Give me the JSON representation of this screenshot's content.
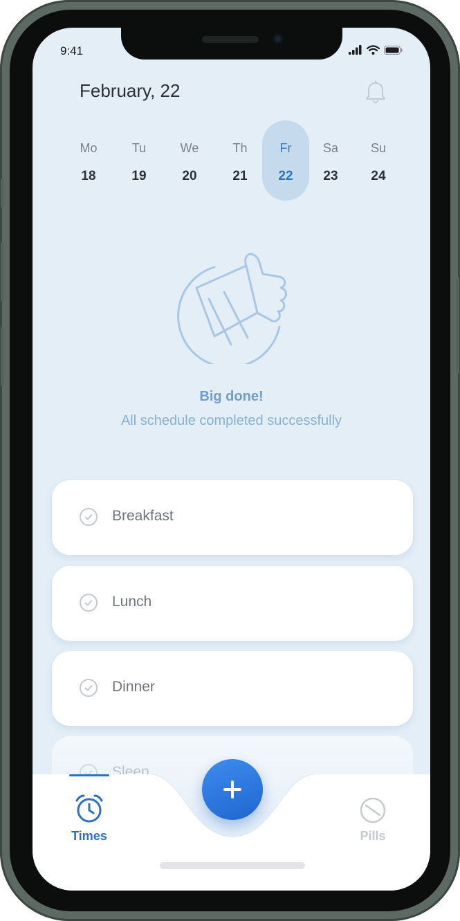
{
  "status_bar": {
    "time": "9:41"
  },
  "header": {
    "date": "February, 22"
  },
  "week": [
    {
      "name": "Mo",
      "num": "18",
      "selected": false
    },
    {
      "name": "Tu",
      "num": "19",
      "selected": false
    },
    {
      "name": "We",
      "num": "20",
      "selected": false
    },
    {
      "name": "Th",
      "num": "21",
      "selected": false
    },
    {
      "name": "Fr",
      "num": "22",
      "selected": true
    },
    {
      "name": "Sa",
      "num": "23",
      "selected": false
    },
    {
      "name": "Su",
      "num": "24",
      "selected": false
    }
  ],
  "empty_state": {
    "title": "Big done!",
    "subtitle": "All schedule completed successfully"
  },
  "schedule": [
    {
      "label": "Breakfast",
      "done": true
    },
    {
      "label": "Lunch",
      "done": true
    },
    {
      "label": "Dinner",
      "done": true
    },
    {
      "label": "Sleep",
      "done": true
    }
  ],
  "tabbar": {
    "times_label": "Times",
    "pills_label": "Pills",
    "active": "times"
  },
  "colors": {
    "accent": "#2f6fc0",
    "screen_bg": "#e3eef7",
    "selected_day_bg": "#c6daed",
    "done_title": "#6f9dcc"
  },
  "icons": {
    "bell": "bell-icon",
    "check": "check-circle-icon",
    "times": "alarm-clock-icon",
    "pills": "pill-icon",
    "add": "plus-icon",
    "illustration": "thumbs-up-icon"
  }
}
